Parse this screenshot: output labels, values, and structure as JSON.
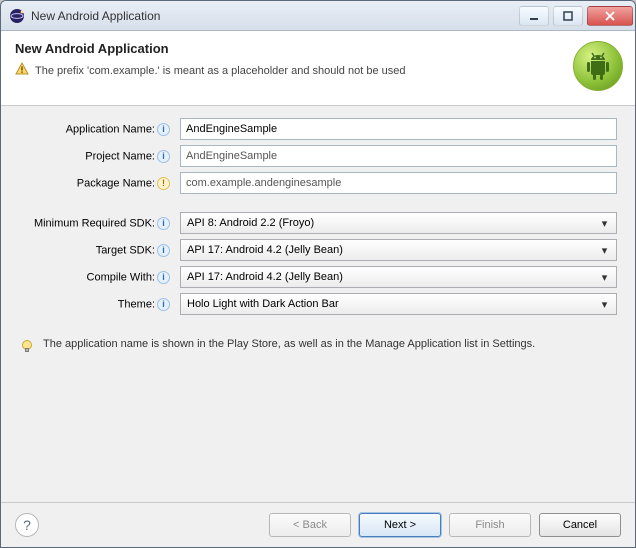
{
  "window": {
    "title": "New Android Application"
  },
  "banner": {
    "heading": "New Android Application",
    "warning": "The prefix 'com.example.' is meant as a placeholder and should not be used"
  },
  "labels": {
    "app_name": "Application Name:",
    "project_name": "Project Name:",
    "package_name": "Package Name:",
    "min_sdk": "Minimum Required SDK:",
    "target_sdk": "Target SDK:",
    "compile_with": "Compile With:",
    "theme": "Theme:"
  },
  "values": {
    "app_name": "AndEngineSample",
    "project_name": "AndEngineSample",
    "package_name": "com.example.andenginesample",
    "min_sdk": "API 8: Android 2.2 (Froyo)",
    "target_sdk": "API 17: Android 4.2 (Jelly Bean)",
    "compile_with": "API 17: Android 4.2 (Jelly Bean)",
    "theme": "Holo Light with Dark Action Bar"
  },
  "hint": "The application name is shown in the Play Store, as well as in the Manage Application list in Settings.",
  "buttons": {
    "back": "< Back",
    "next": "Next >",
    "finish": "Finish",
    "cancel": "Cancel"
  },
  "glyphs": {
    "info": "i",
    "warn": "!",
    "help": "?",
    "arrow": "▾"
  }
}
